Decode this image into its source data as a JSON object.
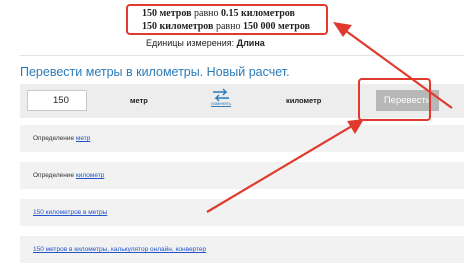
{
  "result": {
    "line1_prefix": "150 метров",
    "line1_mid": " равно ",
    "line1_value": "0.15 километров",
    "line2_prefix": "150 километров",
    "line2_mid": " равно ",
    "line2_value": "150 000 метров"
  },
  "units_line": {
    "label": "Единицы измерения:",
    "value": "Длина"
  },
  "heading": "Перевести метры в километры. Новый расчет.",
  "converter": {
    "input_value": "150",
    "from_unit": "метр",
    "swap_label": "поменять",
    "to_unit": "километр",
    "convert_label": "Перевести"
  },
  "panels": [
    {
      "prefix": "Определение ",
      "link": "метр"
    },
    {
      "prefix": "Определение ",
      "link": "километр"
    },
    {
      "prefix": "",
      "link": "150 километров в метры"
    },
    {
      "prefix": "",
      "link": "150 метров в километры, калькулятор онлайн, конвертер"
    }
  ],
  "colors": {
    "accent": "#2b7bb9",
    "highlight": "#e03a2f",
    "link": "#2255cc"
  }
}
